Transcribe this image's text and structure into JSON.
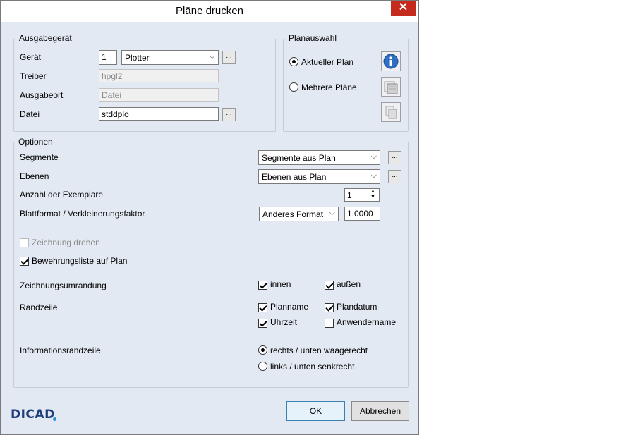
{
  "window": {
    "title": "Pläne drucken",
    "close": "✕"
  },
  "ausgabe": {
    "legend": "Ausgabegerät",
    "geraet_label": "Gerät",
    "geraet_num": "1",
    "geraet_select": "Plotter",
    "treiber_label": "Treiber",
    "treiber_value": "hpgl2",
    "ort_label": "Ausgabeort",
    "ort_value": "Datei",
    "datei_label": "Datei",
    "datei_value": "stddplo",
    "dots": "..."
  },
  "planauswahl": {
    "legend": "Planauswahl",
    "aktuell": "Aktueller Plan",
    "mehrere": "Mehrere Pläne",
    "selected": "aktuell"
  },
  "optionen": {
    "legend": "Optionen",
    "segmente_label": "Segmente",
    "segmente_value": "Segmente aus Plan",
    "ebenen_label": "Ebenen",
    "ebenen_value": "Ebenen aus Plan",
    "anzahl_label": "Anzahl der Exemplare",
    "anzahl_value": "1",
    "blatt_label": "Blattformat / Verkleinerungsfaktor",
    "blatt_value": "Anderes Format",
    "faktor_value": "1.0000",
    "drehen_label": "Zeichnung drehen",
    "bewehrung_label": "Bewehrungsliste auf Plan",
    "umrandung_label": "Zeichnungsumrandung",
    "innen": "innen",
    "aussen": "außen",
    "randzeile_label": "Randzeile",
    "planname": "Planname",
    "plandatum": "Plandatum",
    "uhrzeit": "Uhrzeit",
    "anwendername": "Anwendername",
    "info_label": "Informationsrandzeile",
    "rechts": "rechts / unten waagerecht",
    "links": "links / unten senkrecht",
    "dots": "..."
  },
  "footer": {
    "logo": "DICAD",
    "ok": "OK",
    "cancel": "Abbrechen"
  }
}
